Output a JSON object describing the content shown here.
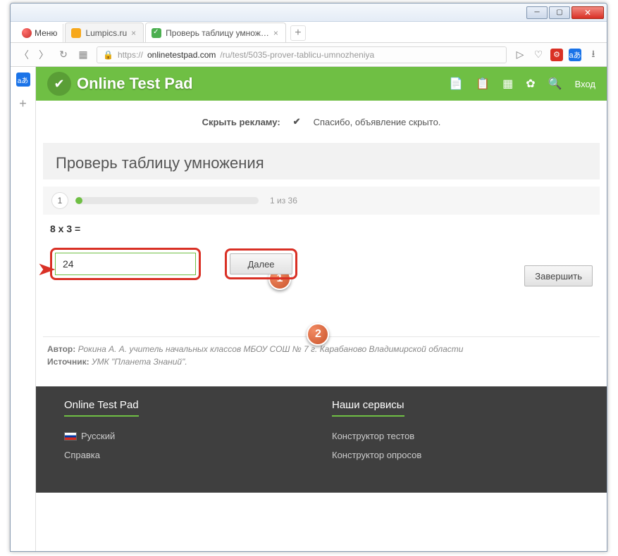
{
  "window": {
    "menu": "Меню",
    "tabs": [
      {
        "label": "Lumpics.ru",
        "active": false
      },
      {
        "label": "Проверь таблицу умнож…",
        "active": true
      }
    ]
  },
  "urlbar": {
    "scheme": "https://",
    "host": "onlinetestpad.com",
    "path": "/ru/test/5035-prover-tablicu-umnozheniya"
  },
  "site": {
    "title": "Online Test Pad",
    "login": "Вход"
  },
  "ad": {
    "hide_label": "Скрыть рекламу:",
    "thanks": "Спасибо, объявление скрыто."
  },
  "test": {
    "title": "Проверь таблицу умножения",
    "current_q": "1",
    "progress_text": "1 из 36",
    "question": "8 x 3 =",
    "answer_value": "24",
    "next": "Далее",
    "finish": "Завершить"
  },
  "badges": {
    "b1": "1",
    "b2": "2"
  },
  "meta": {
    "author_label": "Автор:",
    "author_text": "Рокина А. А. учитель начальных классов МБОУ СОШ № 7 г. Карабаново Владимирской области",
    "source_label": "Источник:",
    "source_text": "УМК \"Планета Знаний\"."
  },
  "footer": {
    "col1_head": "Online Test Pad",
    "lang": "Русский",
    "help": "Справка",
    "col2_head": "Наши сервисы",
    "s1": "Конструктор тестов",
    "s2": "Конструктор опросов"
  }
}
